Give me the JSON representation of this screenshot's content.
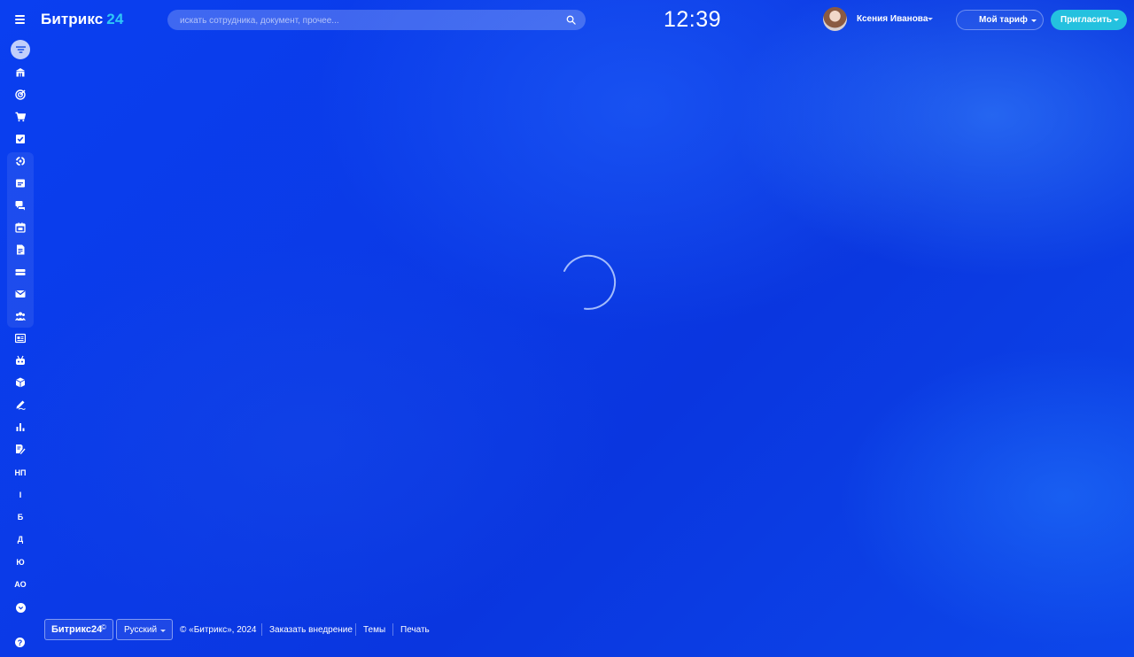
{
  "header": {
    "logo_text": "Битрикс",
    "logo_number": "24",
    "search_placeholder": "искать сотрудника, документ, прочее...",
    "clock": "12:39",
    "user_name": "Ксения Иванова",
    "tariff_label": "Мой тариф",
    "invite_label": "Пригласить"
  },
  "leftmenu": {
    "text_items": [
      "НП",
      "I",
      "Б",
      "Д",
      "Ю",
      "АО"
    ],
    "help_label": "?"
  },
  "footer": {
    "logo_text": "Битрикс24",
    "logo_mark": "©",
    "language": "Русский",
    "copyright": "© «Битрикс», 2024",
    "order_link": "Заказать внедрение",
    "themes_link": "Темы",
    "print_link": "Печать"
  },
  "colors": {
    "background": "#0b3ae6",
    "accent_logo": "#2fc7f7",
    "invite_button": "#24c1df"
  }
}
